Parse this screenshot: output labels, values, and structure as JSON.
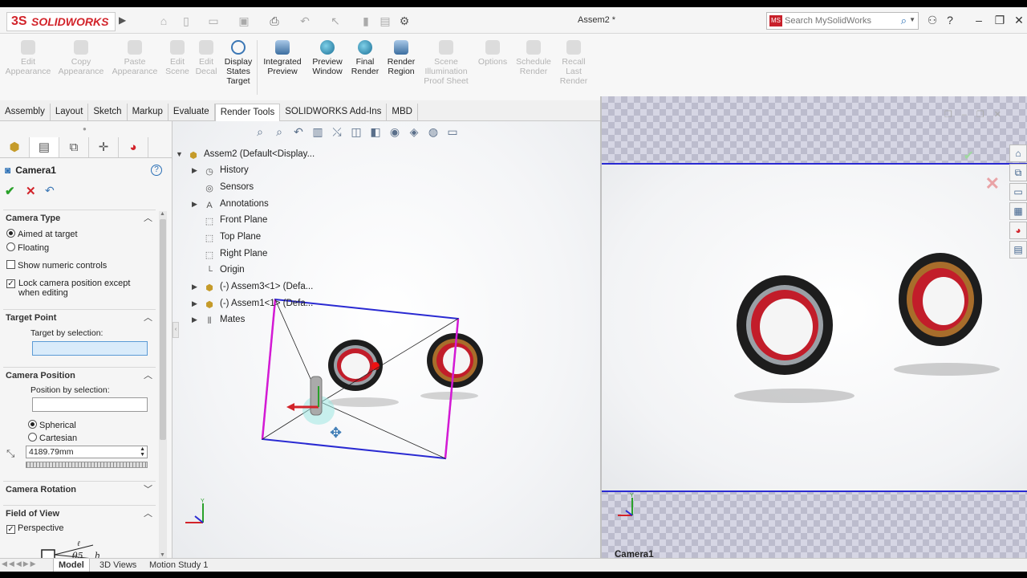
{
  "app": {
    "brand": "SOLIDWORKS",
    "brand_prefix": "3S",
    "doc_title": "Assem2 *"
  },
  "search": {
    "placeholder": "Search MySolidWorks",
    "badge": "MS"
  },
  "ribbon": {
    "items": [
      {
        "label": "Edit\nAppearance",
        "enabled": false
      },
      {
        "label": "Copy\nAppearance",
        "enabled": false
      },
      {
        "label": "Paste\nAppearance",
        "enabled": false
      },
      {
        "label": "Edit\nScene",
        "enabled": false
      },
      {
        "label": "Edit\nDecal",
        "enabled": false
      },
      {
        "label": "Display\nStates\nTarget",
        "enabled": true
      },
      {
        "label": "Integrated\nPreview",
        "enabled": true
      },
      {
        "label": "Preview\nWindow",
        "enabled": true
      },
      {
        "label": "Final\nRender",
        "enabled": true
      },
      {
        "label": "Render\nRegion",
        "enabled": true
      },
      {
        "label": "Scene\nIllumination\nProof Sheet",
        "enabled": false
      },
      {
        "label": "Options",
        "enabled": false
      },
      {
        "label": "Schedule\nRender",
        "enabled": false
      },
      {
        "label": "Recall\nLast\nRender",
        "enabled": false
      }
    ]
  },
  "tabs": [
    "Assembly",
    "Layout",
    "Sketch",
    "Markup",
    "Evaluate",
    "Render Tools",
    "SOLIDWORKS Add-Ins",
    "MBD"
  ],
  "active_tab": "Render Tools",
  "property_manager": {
    "title": "Camera1",
    "camera_type": {
      "heading": "Camera Type",
      "aimed": "Aimed at target",
      "floating": "Floating",
      "show_numeric": "Show numeric controls",
      "lock_camera": "Lock camera position except when editing"
    },
    "target_point": {
      "heading": "Target Point",
      "by_selection": "Target by selection:"
    },
    "camera_position": {
      "heading": "Camera Position",
      "by_selection": "Position by selection:",
      "spherical": "Spherical",
      "cartesian": "Cartesian",
      "distance": "4189.79mm"
    },
    "camera_rotation": {
      "heading": "Camera Rotation"
    },
    "field_of_view": {
      "heading": "Field of View",
      "perspective": "Perspective"
    }
  },
  "tree": {
    "root": "Assem2  (Default<Display...",
    "items": [
      {
        "label": "History",
        "expandable": true,
        "icon": "history-icon"
      },
      {
        "label": "Sensors",
        "expandable": false,
        "icon": "sensor-icon"
      },
      {
        "label": "Annotations",
        "expandable": true,
        "icon": "annotation-icon"
      },
      {
        "label": "Front Plane",
        "expandable": false,
        "icon": "plane-icon"
      },
      {
        "label": "Top Plane",
        "expandable": false,
        "icon": "plane-icon"
      },
      {
        "label": "Right Plane",
        "expandable": false,
        "icon": "plane-icon"
      },
      {
        "label": "Origin",
        "expandable": false,
        "icon": "origin-icon"
      },
      {
        "label": "(-) Assem3<1> (Defa...",
        "expandable": true,
        "icon": "assembly-icon"
      },
      {
        "label": "(-) Assem1<1> (Defa...",
        "expandable": true,
        "icon": "assembly-icon"
      },
      {
        "label": "Mates",
        "expandable": true,
        "icon": "mates-icon"
      }
    ]
  },
  "camera_view": {
    "label": "Camera1"
  },
  "bottom_tabs": [
    "Model",
    "3D Views",
    "Motion Study 1"
  ],
  "active_bottom_tab": "Model",
  "colors": {
    "brand_red": "#d2232a",
    "camera_frame": "#2a2ad2",
    "camera_box_side": "#d41ad4",
    "ok_green": "#2aa12a"
  }
}
